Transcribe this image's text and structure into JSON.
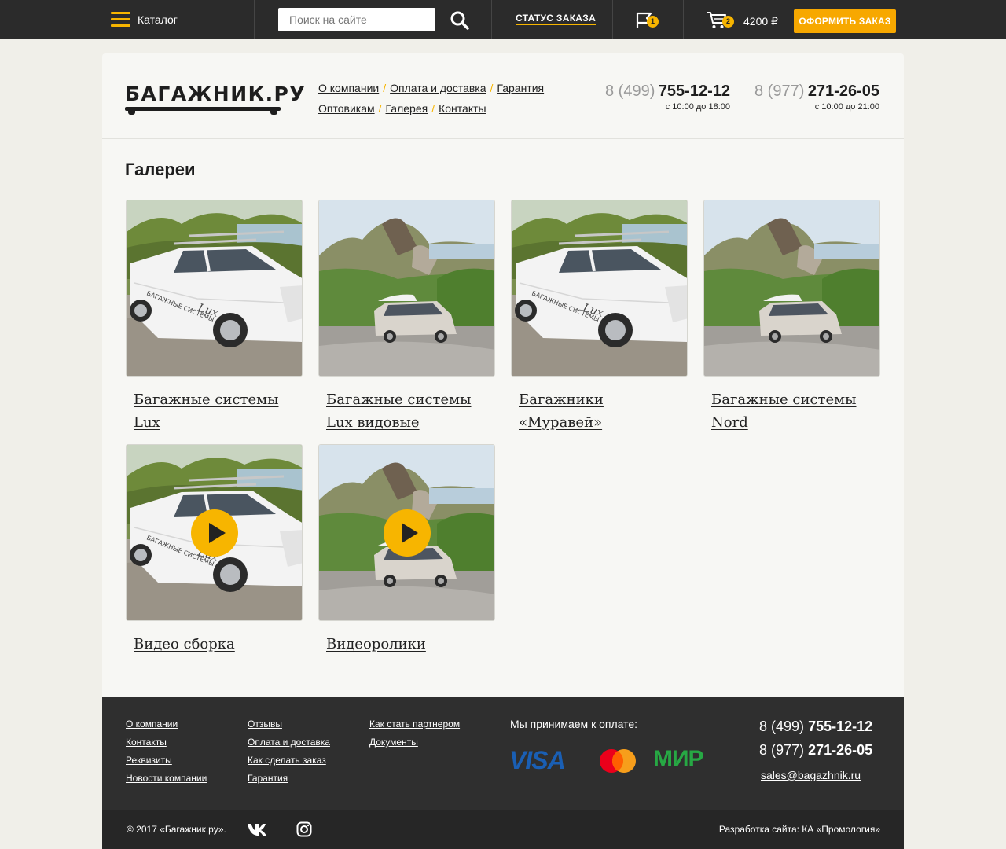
{
  "topbar": {
    "catalog_label": "Каталог",
    "search_placeholder": "Поиск на сайте",
    "status_label": "СТАТУС ЗАКАЗА",
    "favorites_count": "1",
    "cart_count": "2",
    "cart_total": "4200 ₽",
    "order_button": "ОФОРМИТЬ ЗАКАЗ",
    "accent_color": "#f7b500"
  },
  "header": {
    "logo_text": "БАГАЖНИК.РУ",
    "nav_row1": [
      "О компании",
      "Оплата и доставка",
      "Гарантия"
    ],
    "nav_row2": [
      "Оптовикам",
      "Галерея",
      "Контакты"
    ],
    "phones": [
      {
        "code": "8 (499)",
        "number": "755-12-12",
        "hours": "с 10:00 до 18:00"
      },
      {
        "code": "8 (977)",
        "number": "271-26-05",
        "hours": "с 10:00 до 21:00"
      }
    ]
  },
  "main": {
    "title": "Галереи",
    "galleries": [
      {
        "title": "Багажные системы Lux",
        "image": "car-white",
        "video": false
      },
      {
        "title": "Багажные системы Lux видовые",
        "image": "car-mountain",
        "video": false
      },
      {
        "title": "Багажники «Муравей»",
        "image": "car-white",
        "video": false
      },
      {
        "title": "Багажные системы Nord",
        "image": "car-mountain",
        "video": false
      },
      {
        "title": "Видео сборка",
        "image": "car-white",
        "video": true
      },
      {
        "title": "Видеоролики",
        "image": "car-mountain",
        "video": true
      }
    ]
  },
  "footer": {
    "col1": [
      "О компании",
      "Контакты",
      "Реквизиты",
      "Новости компании"
    ],
    "col2": [
      "Отзывы",
      "Оплата и доставка",
      "Как сделать заказ",
      "Гарантия"
    ],
    "col3": [
      "Как стать партнером",
      "Документы"
    ],
    "payment_label": "Мы принимаем к оплате:",
    "payment_logos": [
      "VISA",
      "mastercard",
      "МИР"
    ],
    "phones": [
      {
        "code": "8 (499)",
        "number": "755-12-12"
      },
      {
        "code": "8 (977)",
        "number": "271-26-05"
      }
    ],
    "email": "sales@bagazhnik.ru",
    "copyright": "© 2017 «Багажник.ру».",
    "developer": "Разработка сайта: КА «Промология»"
  }
}
